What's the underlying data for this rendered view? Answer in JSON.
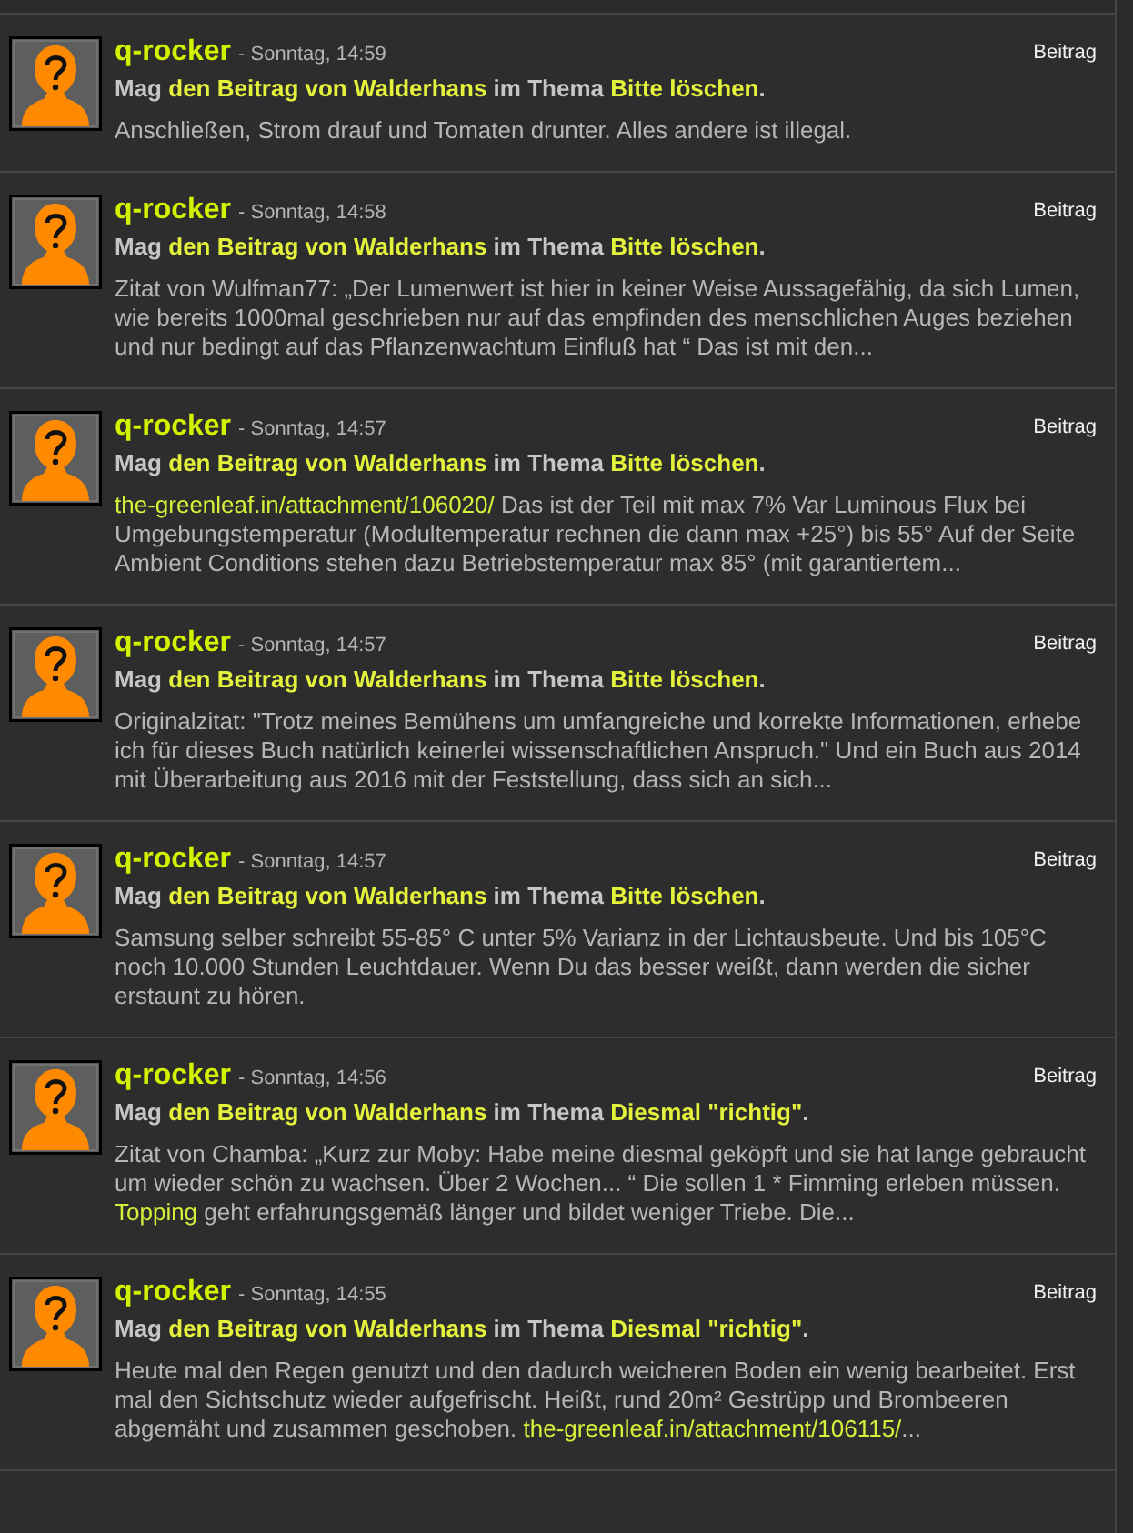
{
  "items": [
    {
      "user": "q-rocker",
      "meta": "- Sonntag, 14:59",
      "type_label": "Beitrag",
      "action": {
        "verb": "Mag",
        "post_link": "den Beitrag von Walderhans",
        "connector": "im Thema",
        "thread_link": "Bitte löschen",
        "end": "."
      },
      "body": [
        {
          "kind": "text",
          "text": "Anschließen, Strom drauf und Tomaten drunter. Alles andere ist illegal."
        }
      ]
    },
    {
      "user": "q-rocker",
      "meta": "- Sonntag, 14:58",
      "type_label": "Beitrag",
      "action": {
        "verb": "Mag",
        "post_link": "den Beitrag von Walderhans",
        "connector": "im Thema",
        "thread_link": "Bitte löschen",
        "end": "."
      },
      "body": [
        {
          "kind": "text",
          "text": "Zitat von Wulfman77: „Der Lumenwert ist hier in keiner Weise Aussagefähig, da sich Lumen, wie bereits 1000mal geschrieben nur auf das empfinden des menschlichen Auges beziehen und nur bedingt auf das Pflanzenwachtum Einfluß hat “ Das ist mit den..."
        }
      ]
    },
    {
      "user": "q-rocker",
      "meta": "- Sonntag, 14:57",
      "type_label": "Beitrag",
      "action": {
        "verb": "Mag",
        "post_link": "den Beitrag von Walderhans",
        "connector": "im Thema",
        "thread_link": "Bitte löschen",
        "end": "."
      },
      "body": [
        {
          "kind": "link",
          "text": "the-greenleaf.in/attachment/106020/"
        },
        {
          "kind": "text",
          "text": " Das ist der Teil mit max 7% Var Luminous Flux bei Umgebungstemperatur (Modultemperatur rechnen die dann max +25°) bis 55° Auf der Seite Ambient Conditions stehen dazu Betriebstemperatur max 85° (mit garantiertem..."
        }
      ]
    },
    {
      "user": "q-rocker",
      "meta": "- Sonntag, 14:57",
      "type_label": "Beitrag",
      "action": {
        "verb": "Mag",
        "post_link": "den Beitrag von Walderhans",
        "connector": "im Thema",
        "thread_link": "Bitte löschen",
        "end": "."
      },
      "body": [
        {
          "kind": "text",
          "text": "Originalzitat: \"Trotz meines Bemühens um umfangreiche und korrekte Informationen, erhebe ich für dieses Buch natürlich keinerlei wissenschaftlichen Anspruch.\" Und ein Buch aus 2014 mit Überarbeitung aus 2016 mit der Feststellung, dass sich an sich..."
        }
      ]
    },
    {
      "user": "q-rocker",
      "meta": "- Sonntag, 14:57",
      "type_label": "Beitrag",
      "action": {
        "verb": "Mag",
        "post_link": "den Beitrag von Walderhans",
        "connector": "im Thema",
        "thread_link": "Bitte löschen",
        "end": "."
      },
      "body": [
        {
          "kind": "text",
          "text": "Samsung selber schreibt 55-85° C unter 5% Varianz in der Lichtausbeute. Und bis 105°C noch 10.000 Stunden Leuchtdauer. Wenn Du das besser weißt, dann werden die sicher erstaunt zu hören."
        }
      ]
    },
    {
      "user": "q-rocker",
      "meta": "- Sonntag, 14:56",
      "type_label": "Beitrag",
      "action": {
        "verb": "Mag",
        "post_link": "den Beitrag von Walderhans",
        "connector": "im Thema",
        "thread_link": "Diesmal \"richtig\"",
        "end": "."
      },
      "body": [
        {
          "kind": "text",
          "text": "Zitat von Chamba: „Kurz zur Moby: Habe meine diesmal geköpft und sie hat lange gebraucht um wieder schön zu wachsen. Über 2 Wochen... “ Die sollen 1 * Fimming erleben müssen. "
        },
        {
          "kind": "link",
          "text": "Topping"
        },
        {
          "kind": "text",
          "text": " geht erfahrungsgemäß länger und bildet weniger Triebe. Die..."
        }
      ]
    },
    {
      "user": "q-rocker",
      "meta": "- Sonntag, 14:55",
      "type_label": "Beitrag",
      "action": {
        "verb": "Mag",
        "post_link": "den Beitrag von Walderhans",
        "connector": "im Thema",
        "thread_link": "Diesmal \"richtig\"",
        "end": "."
      },
      "body": [
        {
          "kind": "text",
          "text": "Heute mal den Regen genutzt und den dadurch weicheren Boden ein wenig bearbeitet. Erst mal den Sichtschutz wieder aufgefrischt. Heißt, rund 20m² Gestrüpp und Brombeeren abgemäht und zusammen geschoben. "
        },
        {
          "kind": "link",
          "text": "the-greenleaf.in/attachment/106115/"
        },
        {
          "kind": "text",
          "text": "..."
        }
      ]
    }
  ]
}
